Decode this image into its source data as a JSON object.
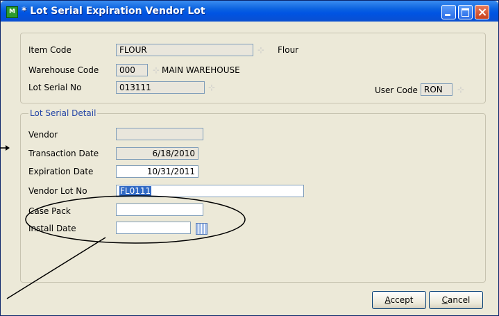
{
  "window": {
    "title": "* Lot Serial Expiration Vendor Lot",
    "icon": "app-grid-icon"
  },
  "header": {
    "item_code_label": "Item Code",
    "item_code_value": "FLOUR",
    "item_desc": "Flour",
    "warehouse_label": "Warehouse Code",
    "warehouse_value": "000",
    "warehouse_desc": "MAIN WAREHOUSE",
    "lot_label": "Lot Serial No",
    "lot_value": "013111",
    "user_code_label": "User Code",
    "user_code_value": "RON"
  },
  "detail": {
    "legend": "Lot Serial Detail",
    "vendor_label": "Vendor",
    "vendor_value": "",
    "trans_date_label": "Transaction Date",
    "trans_date_value": "6/18/2010",
    "exp_date_label": "Expiration Date",
    "exp_date_value": "10/31/2011",
    "vendor_lot_label": "Vendor Lot No",
    "vendor_lot_value": "FL0111",
    "case_pack_label": "Case Pack",
    "case_pack_value": "",
    "install_date_label": "Install Date",
    "install_date_value": ""
  },
  "buttons": {
    "accept_hotkey": "A",
    "accept_rest": "ccept",
    "cancel_hotkey": "C",
    "cancel_rest": "ancel"
  },
  "colors": {
    "title_bar": "#0054e3",
    "window_bg": "#ece9d8",
    "field_border": "#7f9db9",
    "legend_text": "#2546a6",
    "selection": "#316ac5"
  }
}
